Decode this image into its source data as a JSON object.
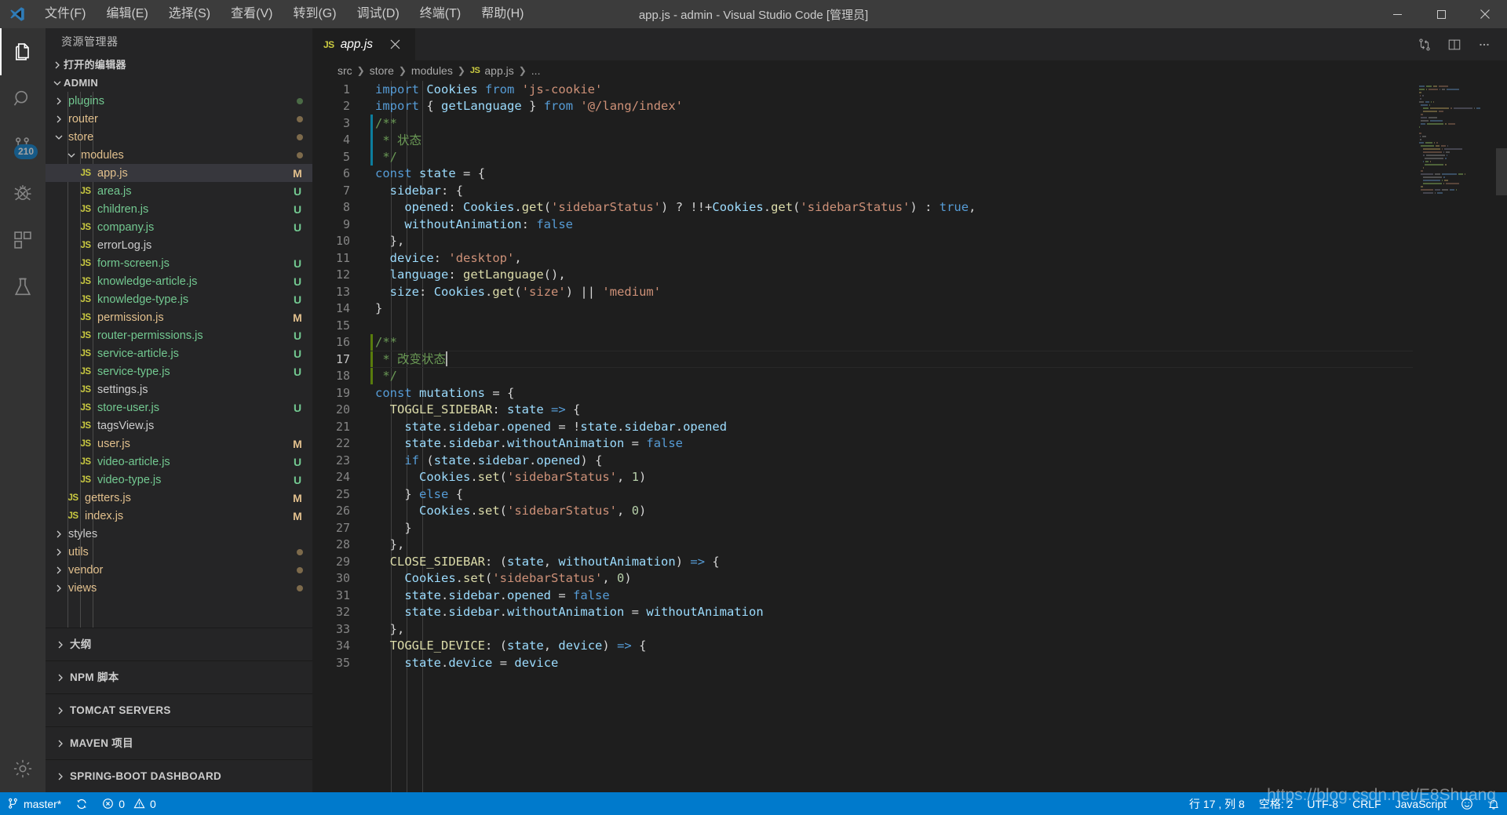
{
  "titlebar": {
    "logo_icon": "vscode-logo-icon",
    "title": "app.js - admin - Visual Studio Code [管理员]",
    "menus": [
      {
        "label": "文件(F)",
        "name": "menu-file"
      },
      {
        "label": "编辑(E)",
        "name": "menu-edit"
      },
      {
        "label": "选择(S)",
        "name": "menu-selection"
      },
      {
        "label": "查看(V)",
        "name": "menu-view"
      },
      {
        "label": "转到(G)",
        "name": "menu-go"
      },
      {
        "label": "调试(D)",
        "name": "menu-debug"
      },
      {
        "label": "终端(T)",
        "name": "menu-terminal"
      },
      {
        "label": "帮助(H)",
        "name": "menu-help"
      }
    ],
    "window_controls": [
      {
        "name": "minimize-button",
        "glyph": "─"
      },
      {
        "name": "maximize-button",
        "glyph": "☐"
      },
      {
        "name": "close-button",
        "glyph": "✕"
      }
    ]
  },
  "activitybar": {
    "items": [
      {
        "name": "activity-explorer",
        "icon": "files-icon",
        "active": true,
        "badge": null
      },
      {
        "name": "activity-search",
        "icon": "search-icon",
        "active": false,
        "badge": null
      },
      {
        "name": "activity-source-control",
        "icon": "source-control-icon",
        "active": false,
        "badge": "210"
      },
      {
        "name": "activity-debug",
        "icon": "debug-bug-icon",
        "active": false,
        "badge": null
      },
      {
        "name": "activity-extensions",
        "icon": "extensions-icon",
        "active": false,
        "badge": null
      },
      {
        "name": "activity-testing",
        "icon": "beaker-icon",
        "active": false,
        "badge": null
      }
    ],
    "bottom": [
      {
        "name": "activity-manage-settings",
        "icon": "gear-icon"
      }
    ]
  },
  "sidebar": {
    "title": "资源管理器",
    "open_editors_label": "打开的编辑器",
    "project_label": "ADMIN",
    "tree": [
      {
        "label": "plugins",
        "kind": "folder",
        "depth": 1,
        "expanded": false,
        "status": "",
        "dot": true,
        "color": "c-untr"
      },
      {
        "label": "router",
        "kind": "folder",
        "depth": 1,
        "expanded": false,
        "status": "",
        "dot": true,
        "color": "c-mod"
      },
      {
        "label": "store",
        "kind": "folder",
        "depth": 1,
        "expanded": true,
        "status": "",
        "dot": true,
        "color": "c-mod"
      },
      {
        "label": "modules",
        "kind": "folder",
        "depth": 2,
        "expanded": true,
        "status": "",
        "dot": true,
        "color": "c-mod"
      },
      {
        "label": "app.js",
        "kind": "file",
        "depth": 3,
        "status": "M",
        "color": "c-mod",
        "selected": true
      },
      {
        "label": "area.js",
        "kind": "file",
        "depth": 3,
        "status": "U",
        "color": "c-untr"
      },
      {
        "label": "children.js",
        "kind": "file",
        "depth": 3,
        "status": "U",
        "color": "c-untr"
      },
      {
        "label": "company.js",
        "kind": "file",
        "depth": 3,
        "status": "U",
        "color": "c-untr"
      },
      {
        "label": "errorLog.js",
        "kind": "file",
        "depth": 3,
        "status": "",
        "color": "c-norm"
      },
      {
        "label": "form-screen.js",
        "kind": "file",
        "depth": 3,
        "status": "U",
        "color": "c-untr"
      },
      {
        "label": "knowledge-article.js",
        "kind": "file",
        "depth": 3,
        "status": "U",
        "color": "c-untr"
      },
      {
        "label": "knowledge-type.js",
        "kind": "file",
        "depth": 3,
        "status": "U",
        "color": "c-untr"
      },
      {
        "label": "permission.js",
        "kind": "file",
        "depth": 3,
        "status": "M",
        "color": "c-mod"
      },
      {
        "label": "router-permissions.js",
        "kind": "file",
        "depth": 3,
        "status": "U",
        "color": "c-untr"
      },
      {
        "label": "service-article.js",
        "kind": "file",
        "depth": 3,
        "status": "U",
        "color": "c-untr"
      },
      {
        "label": "service-type.js",
        "kind": "file",
        "depth": 3,
        "status": "U",
        "color": "c-untr"
      },
      {
        "label": "settings.js",
        "kind": "file",
        "depth": 3,
        "status": "",
        "color": "c-norm"
      },
      {
        "label": "store-user.js",
        "kind": "file",
        "depth": 3,
        "status": "U",
        "color": "c-untr"
      },
      {
        "label": "tagsView.js",
        "kind": "file",
        "depth": 3,
        "status": "",
        "color": "c-norm"
      },
      {
        "label": "user.js",
        "kind": "file",
        "depth": 3,
        "status": "M",
        "color": "c-mod"
      },
      {
        "label": "video-article.js",
        "kind": "file",
        "depth": 3,
        "status": "U",
        "color": "c-untr"
      },
      {
        "label": "video-type.js",
        "kind": "file",
        "depth": 3,
        "status": "U",
        "color": "c-untr"
      },
      {
        "label": "getters.js",
        "kind": "file",
        "depth": 2,
        "status": "M",
        "color": "c-mod"
      },
      {
        "label": "index.js",
        "kind": "file",
        "depth": 2,
        "status": "M",
        "color": "c-mod"
      },
      {
        "label": "styles",
        "kind": "folder",
        "depth": 1,
        "expanded": false,
        "status": "",
        "dot": false,
        "color": "c-norm"
      },
      {
        "label": "utils",
        "kind": "folder",
        "depth": 1,
        "expanded": false,
        "status": "",
        "dot": true,
        "color": "c-mod"
      },
      {
        "label": "vendor",
        "kind": "folder",
        "depth": 1,
        "expanded": false,
        "status": "",
        "dot": true,
        "color": "c-mod"
      },
      {
        "label": "views",
        "kind": "folder",
        "depth": 1,
        "expanded": false,
        "status": "",
        "dot": true,
        "color": "c-mod"
      }
    ],
    "bottom_sections": [
      {
        "label": "大纲",
        "name": "section-outline"
      },
      {
        "label": "NPM 脚本",
        "name": "section-npm-scripts"
      },
      {
        "label": "TOMCAT SERVERS",
        "name": "section-tomcat-servers"
      },
      {
        "label": "MAVEN 项目",
        "name": "section-maven-projects"
      },
      {
        "label": "SPRING-BOOT DASHBOARD",
        "name": "section-spring-boot-dashboard"
      }
    ]
  },
  "editor": {
    "tab": {
      "label": "app.js",
      "icon": "js-file-icon",
      "close_icon": "close-icon"
    },
    "actions": [
      {
        "name": "split-diff-icon",
        "icon": "compare-changes-icon"
      },
      {
        "name": "split-editor-button",
        "icon": "split-editor-icon"
      },
      {
        "name": "more-actions-button",
        "icon": "ellipsis-icon"
      }
    ],
    "breadcrumbs": [
      "src",
      "store",
      "modules",
      "app.js",
      "..."
    ],
    "breadcrumb_file_icon": "js-file-icon",
    "cursor_line": 17,
    "lines": [
      {
        "n": 1,
        "gutter": "",
        "html": "<span class='k'>import</span> <span class='id'>Cookies</span> <span class='k'>from</span> <span class='st2'>'js-cookie'</span>"
      },
      {
        "n": 2,
        "gutter": "",
        "html": "<span class='k'>import</span> <span class='pn'>{</span> <span class='id'>getLanguage</span> <span class='pn'>}</span> <span class='k'>from</span> <span class='st2'>'@/lang/index'</span>"
      },
      {
        "n": 3,
        "gutter": "blue",
        "html": "<span class='cm'>/**</span>"
      },
      {
        "n": 4,
        "gutter": "blue",
        "html": " <span class='cm'>* 状态</span>"
      },
      {
        "n": 5,
        "gutter": "blue",
        "html": " <span class='cm'>*/</span>"
      },
      {
        "n": 6,
        "gutter": "",
        "html": "<span class='k'>const</span> <span class='id'>state</span> <span class='op'>=</span> <span class='pn'>{</span>"
      },
      {
        "n": 7,
        "gutter": "",
        "html": "  <span class='id'>sidebar</span><span class='pn'>:</span> <span class='pn'>{</span>"
      },
      {
        "n": 8,
        "gutter": "",
        "html": "    <span class='id'>opened</span><span class='pn'>:</span> <span class='id'>Cookies</span><span class='pn'>.</span><span class='fn'>get</span><span class='pn'>(</span><span class='st2'>'sidebarStatus'</span><span class='pn'>)</span> <span class='op'>?</span> <span class='op'>!!+</span><span class='id'>Cookies</span><span class='pn'>.</span><span class='fn'>get</span><span class='pn'>(</span><span class='st2'>'sidebarStatus'</span><span class='pn'>)</span> <span class='op'>:</span> <span class='k'>true</span><span class='pn'>,</span>"
      },
      {
        "n": 9,
        "gutter": "",
        "html": "    <span class='id'>withoutAnimation</span><span class='pn'>:</span> <span class='k'>false</span>"
      },
      {
        "n": 10,
        "gutter": "",
        "html": "  <span class='pn'>},</span>"
      },
      {
        "n": 11,
        "gutter": "",
        "html": "  <span class='id'>device</span><span class='pn'>:</span> <span class='st2'>'desktop'</span><span class='pn'>,</span>"
      },
      {
        "n": 12,
        "gutter": "",
        "html": "  <span class='id'>language</span><span class='pn'>:</span> <span class='fn'>getLanguage</span><span class='pn'>(),</span>"
      },
      {
        "n": 13,
        "gutter": "",
        "html": "  <span class='id'>size</span><span class='pn'>:</span> <span class='id'>Cookies</span><span class='pn'>.</span><span class='fn'>get</span><span class='pn'>(</span><span class='st2'>'size'</span><span class='pn'>)</span> <span class='op'>||</span> <span class='st2'>'medium'</span>"
      },
      {
        "n": 14,
        "gutter": "",
        "html": "<span class='pn'>}</span>"
      },
      {
        "n": 15,
        "gutter": "",
        "html": ""
      },
      {
        "n": 16,
        "gutter": "green",
        "html": "<span class='cm'>/**</span>"
      },
      {
        "n": 17,
        "gutter": "green",
        "html": " <span class='cm'>* 改变状态</span><span class='cursor'></span>",
        "current": true
      },
      {
        "n": 18,
        "gutter": "green",
        "html": " <span class='cm'>*/</span>"
      },
      {
        "n": 19,
        "gutter": "",
        "html": "<span class='k'>const</span> <span class='id'>mutations</span> <span class='op'>=</span> <span class='pn'>{</span>"
      },
      {
        "n": 20,
        "gutter": "",
        "html": "  <span class='fn'>TOGGLE_SIDEBAR</span><span class='pn'>:</span> <span class='id'>state</span> <span class='k'>=&gt;</span> <span class='pn'>{</span>"
      },
      {
        "n": 21,
        "gutter": "",
        "html": "    <span class='id'>state</span><span class='pn'>.</span><span class='id'>sidebar</span><span class='pn'>.</span><span class='id'>opened</span> <span class='op'>=</span> <span class='op'>!</span><span class='id'>state</span><span class='pn'>.</span><span class='id'>sidebar</span><span class='pn'>.</span><span class='id'>opened</span>"
      },
      {
        "n": 22,
        "gutter": "",
        "html": "    <span class='id'>state</span><span class='pn'>.</span><span class='id'>sidebar</span><span class='pn'>.</span><span class='id'>withoutAnimation</span> <span class='op'>=</span> <span class='k'>false</span>"
      },
      {
        "n": 23,
        "gutter": "",
        "html": "    <span class='k'>if</span> <span class='pn'>(</span><span class='id'>state</span><span class='pn'>.</span><span class='id'>sidebar</span><span class='pn'>.</span><span class='id'>opened</span><span class='pn'>)</span> <span class='pn'>{</span>"
      },
      {
        "n": 24,
        "gutter": "",
        "html": "      <span class='id'>Cookies</span><span class='pn'>.</span><span class='fn'>set</span><span class='pn'>(</span><span class='st2'>'sidebarStatus'</span><span class='pn'>,</span> <span class='nm'>1</span><span class='pn'>)</span>"
      },
      {
        "n": 25,
        "gutter": "",
        "html": "    <span class='pn'>}</span> <span class='k'>else</span> <span class='pn'>{</span>"
      },
      {
        "n": 26,
        "gutter": "",
        "html": "      <span class='id'>Cookies</span><span class='pn'>.</span><span class='fn'>set</span><span class='pn'>(</span><span class='st2'>'sidebarStatus'</span><span class='pn'>,</span> <span class='nm'>0</span><span class='pn'>)</span>"
      },
      {
        "n": 27,
        "gutter": "",
        "html": "    <span class='pn'>}</span>"
      },
      {
        "n": 28,
        "gutter": "",
        "html": "  <span class='pn'>},</span>"
      },
      {
        "n": 29,
        "gutter": "",
        "html": "  <span class='fn'>CLOSE_SIDEBAR</span><span class='pn'>:</span> <span class='pn'>(</span><span class='id'>state</span><span class='pn'>,</span> <span class='id'>withoutAnimation</span><span class='pn'>)</span> <span class='k'>=&gt;</span> <span class='pn'>{</span>"
      },
      {
        "n": 30,
        "gutter": "",
        "html": "    <span class='id'>Cookies</span><span class='pn'>.</span><span class='fn'>set</span><span class='pn'>(</span><span class='st2'>'sidebarStatus'</span><span class='pn'>,</span> <span class='nm'>0</span><span class='pn'>)</span>"
      },
      {
        "n": 31,
        "gutter": "",
        "html": "    <span class='id'>state</span><span class='pn'>.</span><span class='id'>sidebar</span><span class='pn'>.</span><span class='id'>opened</span> <span class='op'>=</span> <span class='k'>false</span>"
      },
      {
        "n": 32,
        "gutter": "",
        "html": "    <span class='id'>state</span><span class='pn'>.</span><span class='id'>sidebar</span><span class='pn'>.</span><span class='id'>withoutAnimation</span> <span class='op'>=</span> <span class='id'>withoutAnimation</span>"
      },
      {
        "n": 33,
        "gutter": "",
        "html": "  <span class='pn'>},</span>"
      },
      {
        "n": 34,
        "gutter": "",
        "html": "  <span class='fn'>TOGGLE_DEVICE</span><span class='pn'>:</span> <span class='pn'>(</span><span class='id'>state</span><span class='pn'>,</span> <span class='id'>device</span><span class='pn'>)</span> <span class='k'>=&gt;</span> <span class='pn'>{</span>"
      },
      {
        "n": 35,
        "gutter": "",
        "html": "    <span class='id'>state</span><span class='pn'>.</span><span class='id'>device</span> <span class='op'>=</span> <span class='id'>device</span>"
      }
    ]
  },
  "statusbar": {
    "left": [
      {
        "name": "status-branch",
        "icon": "source-control-branch-icon",
        "label": "master*"
      },
      {
        "name": "status-sync",
        "icon": "sync-icon",
        "label": ""
      },
      {
        "name": "status-problems",
        "icon": "error-warning-icon",
        "label": "0",
        "label2": "0"
      }
    ],
    "right": [
      {
        "name": "status-cursor-position",
        "label": "行 17 , 列 8"
      },
      {
        "name": "status-indentation",
        "label": "空格: 2"
      },
      {
        "name": "status-encoding",
        "label": "UTF-8"
      },
      {
        "name": "status-eol",
        "label": "CRLF"
      },
      {
        "name": "status-language-mode",
        "label": "JavaScript"
      },
      {
        "name": "status-feedback",
        "icon": "smiley-icon",
        "label": ""
      },
      {
        "name": "status-notifications",
        "icon": "bell-icon",
        "label": ""
      }
    ]
  },
  "watermark": "https://blog.csdn.net/E8Shuang",
  "colors": {
    "accent": "#007ACC",
    "modified": "#E2C08D",
    "untracked": "#73C991",
    "editor_bg": "#1E1E1E",
    "sidebar_bg": "#252526",
    "activitybar_bg": "#333333",
    "titlebar_bg": "#3C3C3C"
  }
}
